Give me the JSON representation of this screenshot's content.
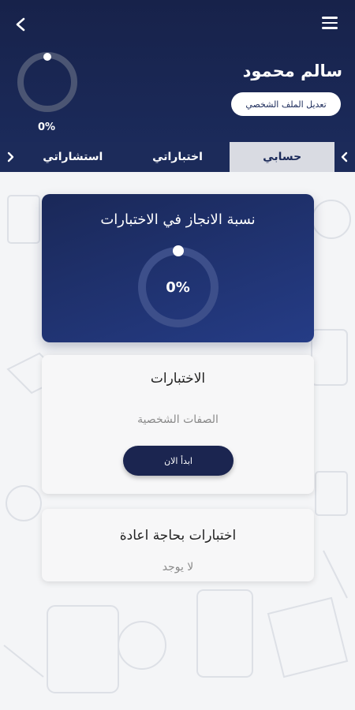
{
  "header": {
    "user_name": "سالم محمود",
    "edit_profile_label": "تعديل الملف الشخصي",
    "progress_label": "0%",
    "progress_value": 0
  },
  "tabs": [
    {
      "label": "استشاراتي",
      "active": false
    },
    {
      "label": "اختباراتي",
      "active": false
    },
    {
      "label": "حسابي",
      "active": true
    }
  ],
  "progress_card": {
    "title": "نسبة الانجاز في الاختبارات",
    "percent_label": "0%",
    "value": 0
  },
  "tests_card": {
    "title": "الاختبارات",
    "subtitle": "الصفات الشخصية",
    "start_label": "ابدأ الان"
  },
  "retry_card": {
    "title": "اختبارات بحاجة اعادة",
    "empty_label": "لا يوجد"
  },
  "colors": {
    "header_bg": "#17224a",
    "accent": "#1b2a5a",
    "active_tab": "#d9dbe2"
  },
  "icons": {
    "menu": "hamburger-menu-icon",
    "back": "chevron-left-icon",
    "tab_prev": "chevron-left-icon",
    "tab_next": "chevron-right-icon"
  }
}
